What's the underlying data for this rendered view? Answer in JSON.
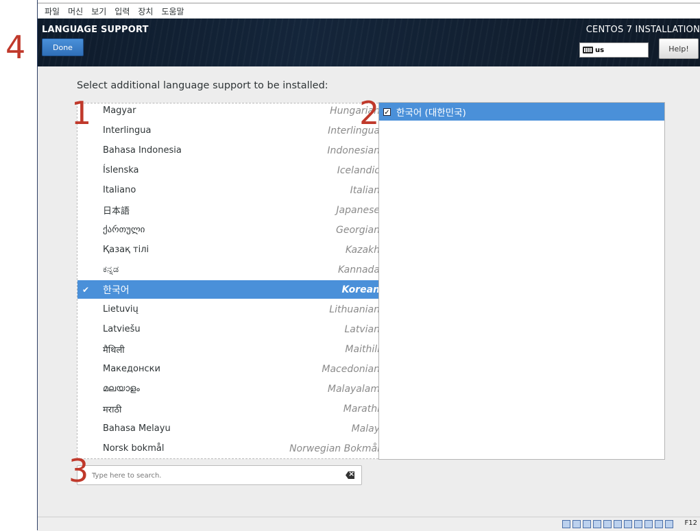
{
  "vm_menu": [
    "파일",
    "머신",
    "보기",
    "입력",
    "장치",
    "도움말"
  ],
  "header": {
    "spoke_title": "LANGUAGE SUPPORT",
    "done_label": "Done",
    "product_title": "CENTOS 7 INSTALLATION",
    "keyboard_layout": "us",
    "help_label": "Help!"
  },
  "prompt": "Select additional language support to be installed:",
  "languages": [
    {
      "native": "Magyar",
      "english": "Hungarian"
    },
    {
      "native": "Interlingua",
      "english": "Interlingua"
    },
    {
      "native": "Bahasa Indonesia",
      "english": "Indonesian"
    },
    {
      "native": "Íslenska",
      "english": "Icelandic"
    },
    {
      "native": "Italiano",
      "english": "Italian"
    },
    {
      "native": "日本語",
      "english": "Japanese"
    },
    {
      "native": "ქართული",
      "english": "Georgian"
    },
    {
      "native": "Қазақ тілі",
      "english": "Kazakh"
    },
    {
      "native": "ಕನ್ನಡ",
      "english": "Kannada"
    },
    {
      "native": "한국어",
      "english": "Korean",
      "selected": true
    },
    {
      "native": "Lietuvių",
      "english": "Lithuanian"
    },
    {
      "native": "Latviešu",
      "english": "Latvian"
    },
    {
      "native": "मैथिली",
      "english": "Maithili"
    },
    {
      "native": "Македонски",
      "english": "Macedonian"
    },
    {
      "native": "മലയാളം",
      "english": "Malayalam"
    },
    {
      "native": "मराठी",
      "english": "Marathi"
    },
    {
      "native": "Bahasa Melayu",
      "english": "Malay"
    },
    {
      "native": "Norsk bokmål",
      "english": "Norwegian Bokmål"
    }
  ],
  "locales": [
    {
      "label": "한국어 (대한민국)",
      "checked": true
    }
  ],
  "search": {
    "placeholder": "Type here to search."
  },
  "annotations": [
    "1",
    "2",
    "3",
    "4"
  ],
  "status_bar": {
    "host_key": "F12"
  },
  "colors": {
    "accent": "#4a90d9",
    "header_bg": "#14253a",
    "annotation": "#c0392b"
  }
}
